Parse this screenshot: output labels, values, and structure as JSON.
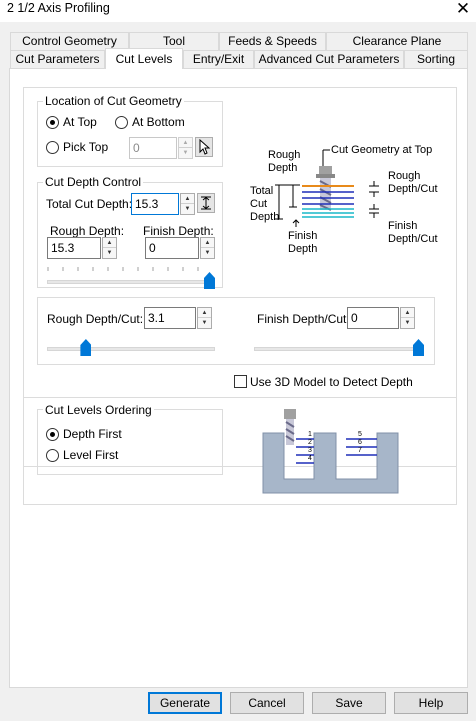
{
  "window": {
    "title": "2 1/2 Axis Profiling",
    "close_glyph": "✕"
  },
  "tabs_row1": [
    "Control Geometry",
    "Tool",
    "Feeds & Speeds",
    "Clearance Plane"
  ],
  "tabs_row2": [
    "Cut Parameters",
    "Cut Levels",
    "Entry/Exit",
    "Advanced Cut Parameters",
    "Sorting"
  ],
  "active_tab": "Cut Levels",
  "location": {
    "title": "Location of Cut Geometry",
    "at_top": "At Top",
    "at_bottom": "At Bottom",
    "pick_top": "Pick Top",
    "pick_top_value": "0",
    "selected": "At Top"
  },
  "depth_control": {
    "title": "Cut Depth Control",
    "total_label": "Total Cut Depth:",
    "total_value": "15.3",
    "rough_label": "Rough Depth:",
    "rough_value": "15.3",
    "finish_label": "Finish Depth:",
    "finish_value": "0",
    "slider_level": 1.0
  },
  "diagram1": {
    "rough_depth": "Rough\nDepth",
    "cut_geometry": "Cut Geometry at Top",
    "total_cut_depth": "Total\nCut\nDepth",
    "rough_depth_cut": "Rough\nDepth/Cut",
    "finish_depth": "Finish\nDepth",
    "finish_depth_cut": "Finish\nDepth/Cut"
  },
  "per_cut": {
    "rough_label": "Rough Depth/Cut:",
    "rough_value": "3.1",
    "rough_slider_level": 0.2,
    "finish_label": "Finish Depth/Cut:",
    "finish_value": "0",
    "finish_slider_level": 1.0
  },
  "use3d": {
    "label": "Use 3D Model to Detect Depth",
    "checked": false
  },
  "ordering": {
    "title": "Cut Levels Ordering",
    "depth_first": "Depth First",
    "level_first": "Level First",
    "selected": "Depth First"
  },
  "diagram2": {
    "left_numbers": [
      "1",
      "2",
      "3",
      "4"
    ],
    "right_numbers": [
      "5",
      "6",
      "7"
    ]
  },
  "buttons": {
    "generate": "Generate",
    "cancel": "Cancel",
    "save": "Save",
    "help": "Help"
  },
  "colors": {
    "accent": "#0078d7",
    "diagram_orange": "#e88a1a",
    "diagram_blue": "#1f2fb8",
    "diagram_cyan": "#19b8c8",
    "pocket_fill": "#a7b6c9"
  }
}
